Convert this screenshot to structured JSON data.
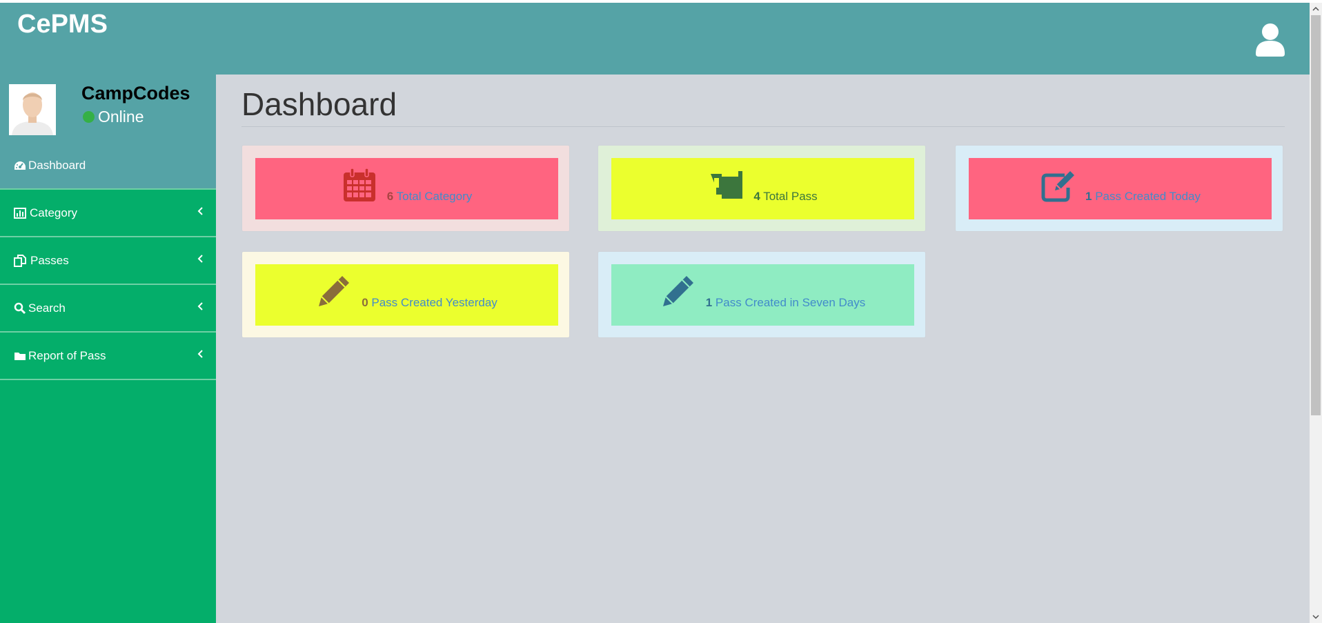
{
  "app": {
    "brand": "CePMS"
  },
  "user_panel": {
    "name": "CampCodes",
    "status": "Online"
  },
  "sidebar": {
    "items": [
      {
        "label": "Dashboard",
        "icon": "dashboard-icon",
        "active": true
      },
      {
        "label": "Category",
        "icon": "bar-chart-icon"
      },
      {
        "label": "Passes",
        "icon": "copy-icon"
      },
      {
        "label": "Search",
        "icon": "search-icon"
      },
      {
        "label": "Report of Pass",
        "icon": "folder-icon"
      }
    ]
  },
  "main": {
    "title": "Dashboard"
  },
  "cards": [
    {
      "count": "6",
      "label": "Total Category",
      "icon": "calendar-icon",
      "outer_bg": "#f2dede",
      "inner_bg": "#ff6480",
      "icon_color": "#c9302c",
      "count_color": "#a94442",
      "label_color": "#428bca"
    },
    {
      "count": "4",
      "label": "Total Pass",
      "icon": "beer-mug-icon",
      "outer_bg": "#dff0d8",
      "inner_bg": "#ebff2e",
      "icon_color": "#3c763d",
      "count_color": "#3c763d",
      "label_color": "#3c763d"
    },
    {
      "count": "1",
      "label": "Pass Created Today",
      "icon": "edit-icon",
      "outer_bg": "#d9edf7",
      "inner_bg": "#ff6480",
      "icon_color": "#31708f",
      "count_color": "#31708f",
      "label_color": "#428bca"
    },
    {
      "count": "0",
      "label": "Pass Created Yesterday",
      "icon": "pencil-icon",
      "outer_bg": "#fcf8e3",
      "inner_bg": "#ebff2e",
      "icon_color": "#8a6d3b",
      "count_color": "#8a6d3b",
      "label_color": "#428bca"
    },
    {
      "count": "1",
      "label": "Pass Created in Seven Days",
      "icon": "pencil-icon",
      "outer_bg": "#d9edf7",
      "inner_bg": "#8fecc2",
      "icon_color": "#31708f",
      "count_color": "#31708f",
      "label_color": "#428bca"
    }
  ]
}
